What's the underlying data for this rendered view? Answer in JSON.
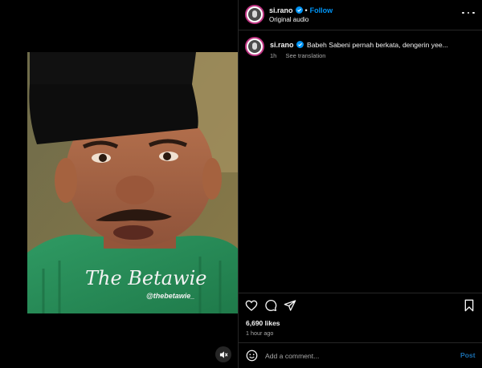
{
  "post": {
    "username": "si.rano",
    "follow_label": "Follow",
    "audio": "Original audio",
    "caption": "Babeh Sabeni pernah berkata, dengerin yee...",
    "caption_age": "1h",
    "see_translation": "See translation",
    "likes": "6,690 likes",
    "posted": "1 hour ago"
  },
  "video": {
    "watermark_title": "The Betawie",
    "watermark_handle": "@thebetawie_"
  },
  "comment": {
    "placeholder": "Add a comment...",
    "post_label": "Post"
  },
  "colors": {
    "background": "#000000",
    "link_blue": "#0095f6",
    "verified_blue": "#0095f6",
    "muted_text": "#a8a8a8",
    "divider": "#262626"
  },
  "icons": [
    "verified-badge-icon",
    "more-options-icon",
    "heart-icon",
    "comment-icon",
    "share-icon",
    "bookmark-icon",
    "emoji-icon",
    "mute-icon"
  ]
}
